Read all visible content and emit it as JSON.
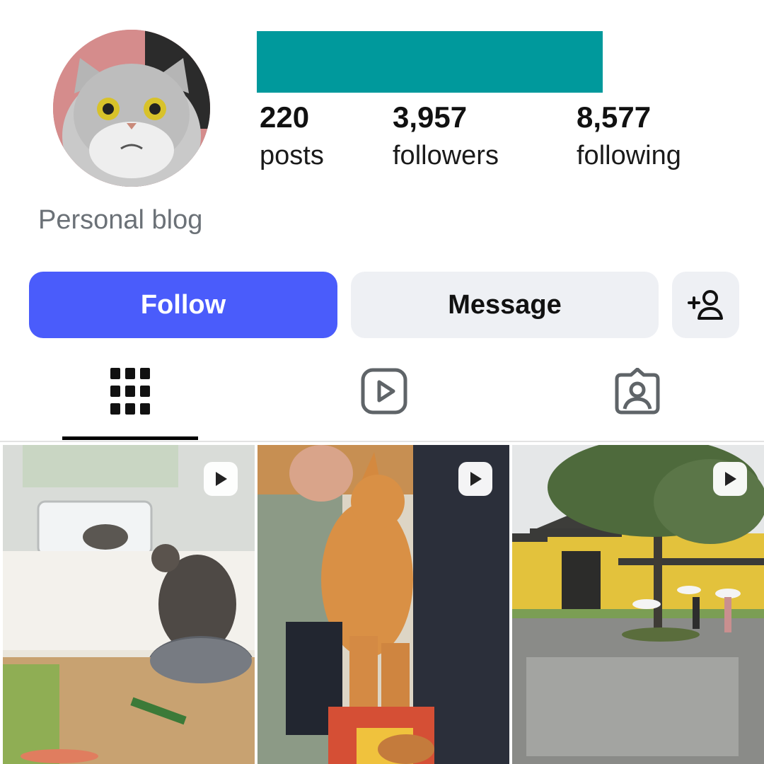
{
  "profile": {
    "name_redacted_color": "#00999c",
    "bio": "Personal blog",
    "avatar_icon": "cat-avatar"
  },
  "stats": [
    {
      "value": "220",
      "label": "posts"
    },
    {
      "value": "3,957",
      "label": "followers"
    },
    {
      "value": "8,577",
      "label": "following"
    }
  ],
  "actions": {
    "follow_label": "Follow",
    "message_label": "Message",
    "add_person_icon": "add-person-icon",
    "follow_color": "#4a5cfb"
  },
  "tabs": [
    {
      "icon": "grid-icon",
      "active": true
    },
    {
      "icon": "reels-icon",
      "active": false
    },
    {
      "icon": "tagged-icon",
      "active": false
    }
  ],
  "posts": [
    {
      "icon": "play-icon",
      "type": "video"
    },
    {
      "icon": "play-icon",
      "type": "video"
    },
    {
      "icon": "play-icon",
      "type": "video"
    }
  ]
}
